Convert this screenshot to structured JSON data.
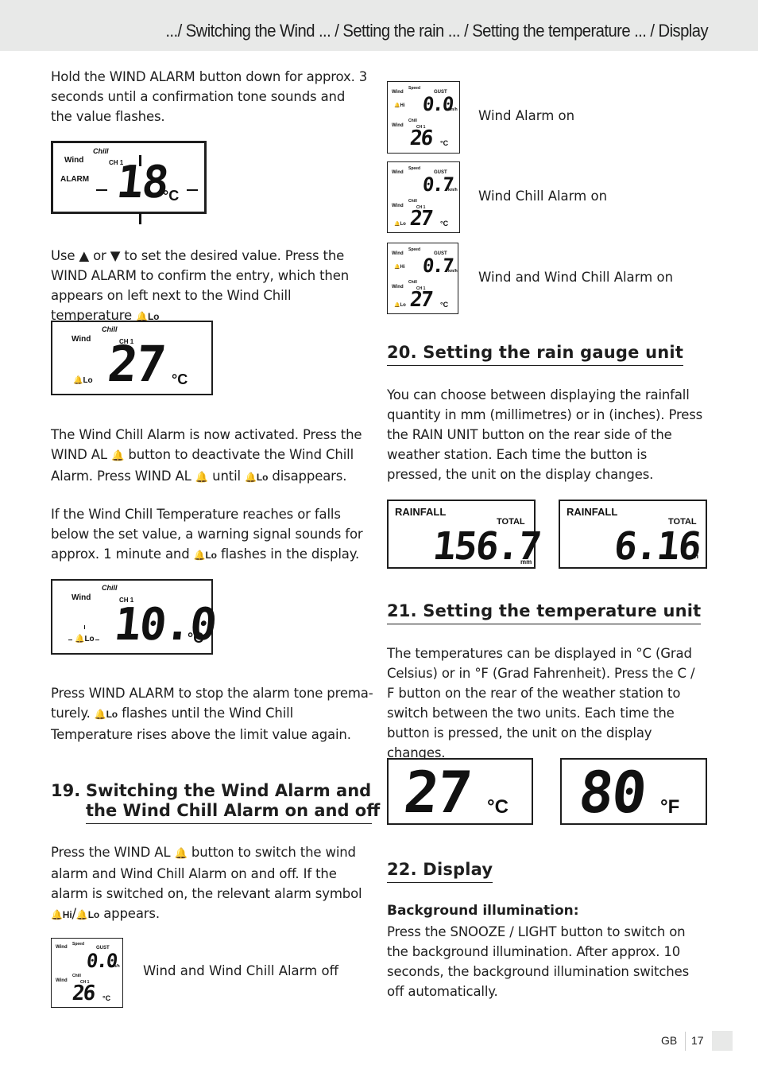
{
  "header": {
    "title": ".../ Switching the Wind ... / Setting the rain ... / Setting the temperature ... / Display"
  },
  "left_column": {
    "p1": "Hold the WIND ALARM button down for approx. 3 seconds until a confirmation tone sounds and the value flashes.",
    "display1": {
      "top_label": "Chill",
      "logo": "Wind",
      "ch": "CH 1",
      "alarm": "ALARM",
      "value": "18",
      "unit": "°C"
    },
    "p2_a": "Use ▲ or ▼ to set the desired value. Press the WIND ALARM to confirm the entry, which then appears on left next to the Wind Chill temperature",
    "p2_sym": "Lo",
    "display2": {
      "top_label": "Chill",
      "logo": "Wind",
      "ch": "CH 1",
      "alarm_sym": "Lo",
      "value": "27",
      "unit": "°C"
    },
    "p3_a": "The Wind Chill Alarm is now activated. Press the WIND AL",
    "p3_b": "button to deactivate the Wind Chill Alarm. Press WIND AL",
    "p3_c": "until",
    "p3_sym": "Lo",
    "p3_d": "disappears.",
    "p4_a": "If the Wind Chill Temperature reaches or falls below the set value, a warning signal sounds for approx. 1 minute and",
    "p4_sym": "Lo",
    "p4_b": "flashes in the display.",
    "display3": {
      "top_label": "Chill",
      "logo": "Wind",
      "ch": "CH 1",
      "alarm_sym": "Lo",
      "value": "10.0",
      "unit": "°C"
    },
    "p5_a": "Press WIND ALARM to stop the alarm tone prema-turely.",
    "p5_sym": "Lo",
    "p5_b": "flashes until the Wind Chill Temperature rises above the limit value again.",
    "section19": {
      "number": "19.",
      "title_line1": "Switching the Wind Alarm and",
      "title_line2": "the Wind Chill Alarm on and off"
    },
    "p6_a": "Press the WIND AL",
    "p6_b": "button to switch the wind alarm and Wind Chill Alarm on and off. If the alarm is switched on, the relevant alarm symbol",
    "p6_sym_hi": "Hi",
    "p6_slash": "/",
    "p6_sym_lo": "Lo",
    "p6_c": "appears.",
    "display_off": {
      "speed_label": "Speed",
      "gust": "GUST",
      "speed_value": "0.0",
      "speed_unit": "km/h",
      "chill_label": "Chill",
      "ch": "CH 1",
      "temp_value": "26",
      "temp_unit": "°C",
      "caption": "Wind and Wind Chill Alarm off"
    }
  },
  "right_column": {
    "alarm_displays": [
      {
        "speed_label": "Speed",
        "gust": "GUST",
        "speed_value": "0.0",
        "speed_unit": "km/h",
        "hi": "Hi",
        "lo": "",
        "chill_label": "Chill",
        "ch": "CH 1",
        "temp_value": "26",
        "temp_unit": "°C",
        "caption": "Wind Alarm on"
      },
      {
        "speed_label": "Speed",
        "gust": "GUST",
        "speed_value": "0.7",
        "speed_unit": "km/h",
        "hi": "",
        "lo": "Lo",
        "chill_label": "Chill",
        "ch": "CH 1",
        "temp_value": "27",
        "temp_unit": "°C",
        "caption": "Wind Chill Alarm on"
      },
      {
        "speed_label": "Speed",
        "gust": "GUST",
        "speed_value": "0.7",
        "speed_unit": "km/h",
        "hi": "Hi",
        "lo": "Lo",
        "chill_label": "Chill",
        "ch": "CH 1",
        "temp_value": "27",
        "temp_unit": "°C",
        "caption": "Wind and Wind Chill Alarm on"
      }
    ],
    "section20": {
      "title": "20. Setting the rain gauge unit",
      "body": "You can choose between displaying the rainfall quantity in mm (millimetres) or in (inches). Press the RAIN UNIT button on the rear side of the weather station. Each time the button is pressed, the unit on the display changes."
    },
    "rain_displays": [
      {
        "label": "RAINFALL",
        "total": "TOTAL",
        "value": "156.7",
        "unit": "mm"
      },
      {
        "label": "RAINFALL",
        "total": "TOTAL",
        "value": "6.16",
        "unit": "in"
      }
    ],
    "section21": {
      "title": "21. Setting the temperature unit",
      "body": "The temperatures can be displayed in °C (Grad Celsius) or in °F (Grad Fahrenheit). Press the C / F button on the rear of the weather station to switch between the two units. Each time the button is pressed, the unit on the display changes."
    },
    "temp_displays": [
      {
        "value": "27",
        "unit": "°C"
      },
      {
        "value": "80",
        "unit": "°F"
      }
    ],
    "section22": {
      "title": "22. Display",
      "subtitle": "Background illumination:",
      "body": "Press the SNOOZE / LIGHT button to switch on the background illumination. After approx. 10 seconds, the background illumination switches off automatically."
    }
  },
  "footer": {
    "lang": "GB",
    "page": "17"
  },
  "icons": {
    "bell": "🔔",
    "up": "▲",
    "down": "▼"
  }
}
